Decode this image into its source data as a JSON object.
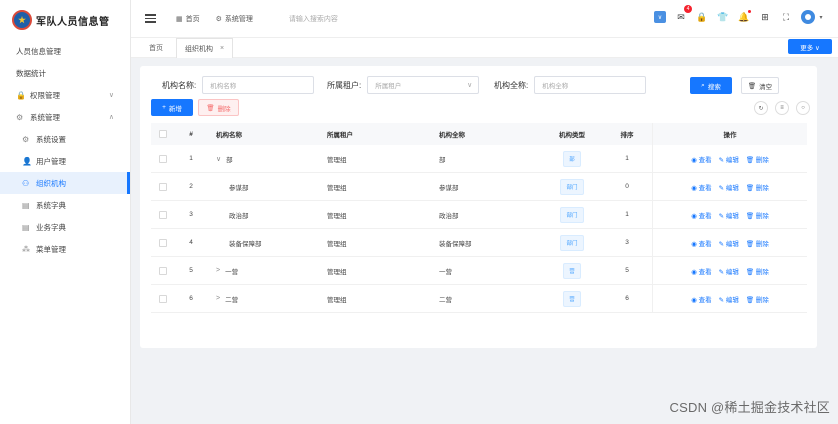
{
  "app": {
    "title": "军队人员信息管"
  },
  "sidebar": {
    "items": [
      {
        "label": "人员信息管理",
        "icon": "none"
      },
      {
        "label": "数据统计",
        "icon": "none"
      },
      {
        "label": "权限管理",
        "icon": "lock-icon",
        "arrow": "∨"
      },
      {
        "label": "系统管理",
        "icon": "gear-icon",
        "arrow": "∧"
      },
      {
        "label": "系统设置",
        "icon": "gear-icon"
      },
      {
        "label": "用户管理",
        "icon": "user-icon"
      },
      {
        "label": "组织机构",
        "icon": "org-icon",
        "active": true
      },
      {
        "label": "系统字典",
        "icon": "dict-icon"
      },
      {
        "label": "业务字典",
        "icon": "dict-icon"
      },
      {
        "label": "菜单管理",
        "icon": "menu-icon"
      }
    ]
  },
  "topbar": {
    "breadcrumb": [
      "首页",
      "系统管理"
    ],
    "search_hint": "请输入搜索内容",
    "notification_count": "4"
  },
  "tabs": [
    {
      "label": "首页"
    },
    {
      "label": "组织机构",
      "close": "×"
    }
  ],
  "more_button": "更多 ∨",
  "filters": {
    "org_name_label": "机构名称:",
    "org_name_placeholder": "机构名称",
    "tenant_label": "所属租户:",
    "tenant_placeholder": "所属租户",
    "full_name_label": "机构全称:",
    "full_name_placeholder": "机构全称"
  },
  "buttons": {
    "search": "搜索",
    "reset": "清空",
    "add": "新增",
    "delete": "删除"
  },
  "table": {
    "headers": [
      "#",
      "机构名称",
      "所属租户",
      "机构全称",
      "机构类型",
      "排序",
      "操作"
    ],
    "ops": [
      "查看",
      "编辑",
      "删除"
    ],
    "rows": [
      {
        "idx": "1",
        "toggle": "∨",
        "name": "部",
        "tenant": "管理组",
        "full": "部",
        "type": "部",
        "sort": "1",
        "indent": 0
      },
      {
        "idx": "2",
        "toggle": "",
        "name": "参谋部",
        "tenant": "管理组",
        "full": "参谋部",
        "type": "部门",
        "sort": "0",
        "indent": 1
      },
      {
        "idx": "3",
        "toggle": "",
        "name": "政治部",
        "tenant": "管理组",
        "full": "政治部",
        "type": "部门",
        "sort": "1",
        "indent": 1
      },
      {
        "idx": "4",
        "toggle": "",
        "name": "装备保障部",
        "tenant": "管理组",
        "full": "装备保障部",
        "type": "部门",
        "sort": "3",
        "indent": 1
      },
      {
        "idx": "5",
        "toggle": ">",
        "name": "一营",
        "tenant": "管理组",
        "full": "一营",
        "type": "营",
        "sort": "5",
        "indent": 0
      },
      {
        "idx": "6",
        "toggle": ">",
        "name": "二营",
        "tenant": "管理组",
        "full": "二营",
        "type": "营",
        "sort": "6",
        "indent": 0
      }
    ]
  },
  "watermark": "CSDN @稀土掘金技术社区"
}
